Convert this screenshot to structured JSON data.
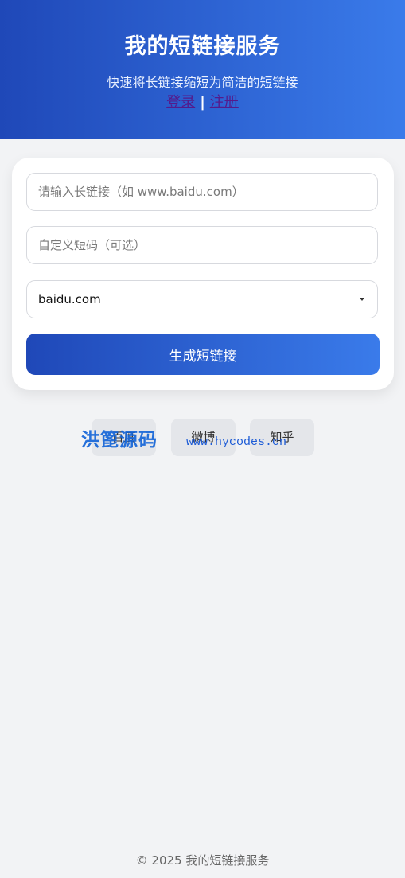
{
  "header": {
    "title": "我的短链接服务",
    "subtitle": "快速将长链接缩短为简洁的短链接",
    "login_label": "登录",
    "separator": "|",
    "register_label": "注册"
  },
  "form": {
    "long_url_placeholder": "请输入长链接（如 www.baidu.com）",
    "custom_code_placeholder": "自定义短码（可选）",
    "domain_selected": "baidu.com",
    "submit_label": "生成短链接"
  },
  "quick_links": [
    "百度",
    "微博",
    "知乎"
  ],
  "watermark": {
    "cn": "洪篦源码",
    "url": "www.hycodes.cn"
  },
  "footer": {
    "text": "© 2025 我的短链接服务"
  },
  "colors": {
    "gradient_start": "#1f48b8",
    "gradient_end": "#3a7bea",
    "page_background": "#f2f3f5"
  }
}
